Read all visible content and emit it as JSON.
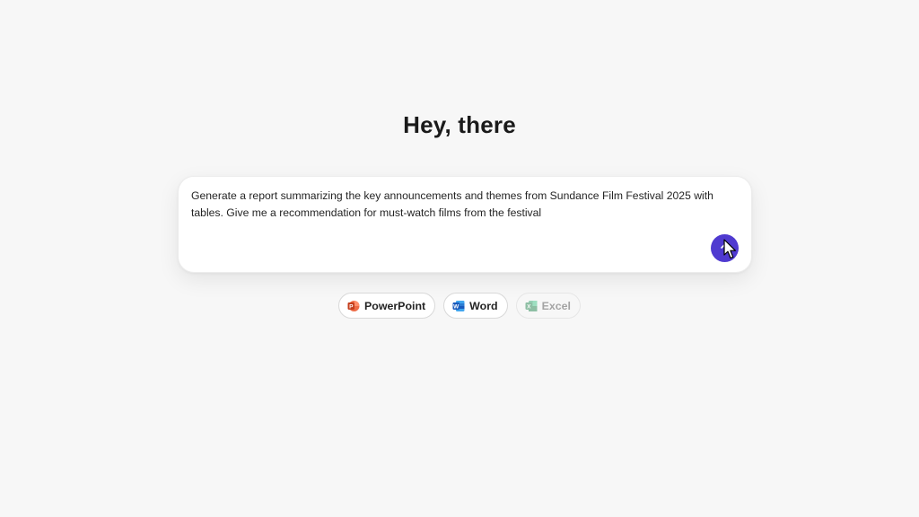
{
  "greeting": "Hey, there",
  "prompt": {
    "value": "Generate a report summarizing the key announcements and themes from Sundance Film Festival 2025 with tables. Give me a recommendation for must-watch films from the festival",
    "send_icon": "send-arrow-icon"
  },
  "chips": [
    {
      "label": "PowerPoint",
      "icon": "powerpoint-icon",
      "enabled": true
    },
    {
      "label": "Word",
      "icon": "word-icon",
      "enabled": true
    },
    {
      "label": "Excel",
      "icon": "excel-icon",
      "enabled": false
    }
  ],
  "colors": {
    "accent": "#4f3ad0",
    "powerpoint": "#c43e1c",
    "word": "#185abd",
    "excel": "#107c41",
    "background": "#f7f7f7"
  }
}
